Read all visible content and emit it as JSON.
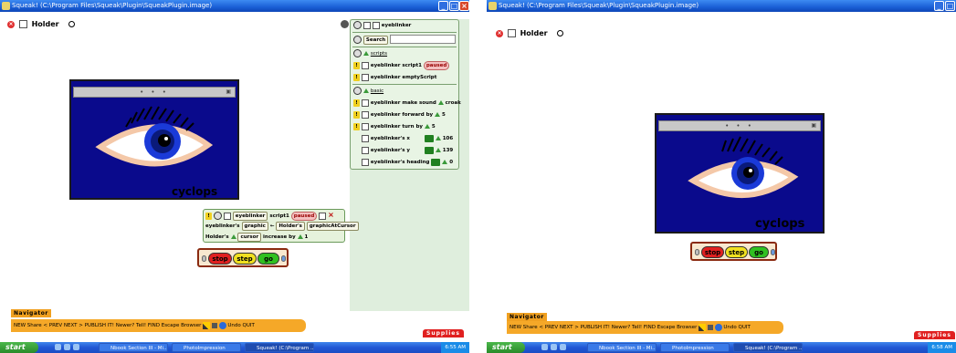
{
  "shots": [
    {
      "id": "left",
      "title": "Squeak! (C:\\Program Files\\Squeak\\Plugin\\SqueakPlugin.image)",
      "holder": "Holder",
      "cyclops": "cyclops",
      "viewer": {
        "object_name": "eyeblinker",
        "search_label": "Search",
        "categories": [
          {
            "name": "scripts",
            "rows": [
              {
                "label": "eyeblinker script1",
                "status": "paused"
              },
              {
                "label": "eyeblinker emptyScript"
              }
            ]
          },
          {
            "name": "basic",
            "rows": [
              {
                "label": "eyeblinker make sound",
                "value": "croak"
              },
              {
                "label": "eyeblinker forward by",
                "value": "5"
              },
              {
                "label": "eyeblinker turn by",
                "value": "5"
              },
              {
                "label": "eyeblinker's x",
                "value": "106"
              },
              {
                "label": "eyeblinker's y",
                "value": "139"
              },
              {
                "label": "eyeblinker's heading",
                "value": "0"
              }
            ]
          }
        ]
      },
      "script": {
        "owner": "eyeblinker",
        "name": "script1",
        "status": "paused",
        "line1_a": "eyeblinker's",
        "line1_b": "graphic",
        "line1_c": "Holder's",
        "line1_d": "graphicAtCursor",
        "line2_a": "Holder's",
        "line2_b": "cursor",
        "line2_c": "increase by",
        "line2_d": "1"
      },
      "controls": {
        "stop": "stop",
        "step": "step",
        "go": "go"
      },
      "navigator": {
        "tab": "Navigator",
        "items": "NEW Share < PREV NEXT > PUBLISH IT! Newer? Tell! FIND Escape Browser",
        "undo": "Undo",
        "quit": "QUIT"
      },
      "supplies": "Supplies",
      "taskbar": {
        "start": "start",
        "tasks": [
          "Nbook Section III - Mi...",
          "PhotoImpression",
          "Squeak! (C:\\Program ..."
        ],
        "clock": "6:55 AM"
      }
    },
    {
      "id": "right",
      "title": "Squeak! (C:\\Program Files\\Squeak\\Plugin\\SqueakPlugin.image)",
      "holder": "Holder",
      "cyclops": "cyclops",
      "controls": {
        "stop": "stop",
        "step": "step",
        "go": "go"
      },
      "navigator": {
        "tab": "Navigator",
        "items": "NEW Share < PREV NEXT > PUBLISH IT! Newer? Tell! FIND Escape Browser",
        "undo": "Undo",
        "quit": "QUIT"
      },
      "supplies": "Supplies",
      "taskbar": {
        "start": "start",
        "tasks": [
          "Nbook Section III - Mi...",
          "PhotoImpression",
          "Squeak! (C:\\Program ..."
        ],
        "clock": "6:58 AM"
      }
    }
  ],
  "colors": {
    "eye_background": "#0a0a8c",
    "iris": "#1a3ad8",
    "stop": "#e02020",
    "step": "#f0e020",
    "go": "#30c020",
    "navigator": "#f5a828",
    "supplies": "#e02020"
  },
  "icons": [
    "close-icon",
    "menu-icon",
    "gear-icon",
    "pen-icon",
    "sound-icon",
    "globe-icon",
    "windows-logo-icon"
  ]
}
